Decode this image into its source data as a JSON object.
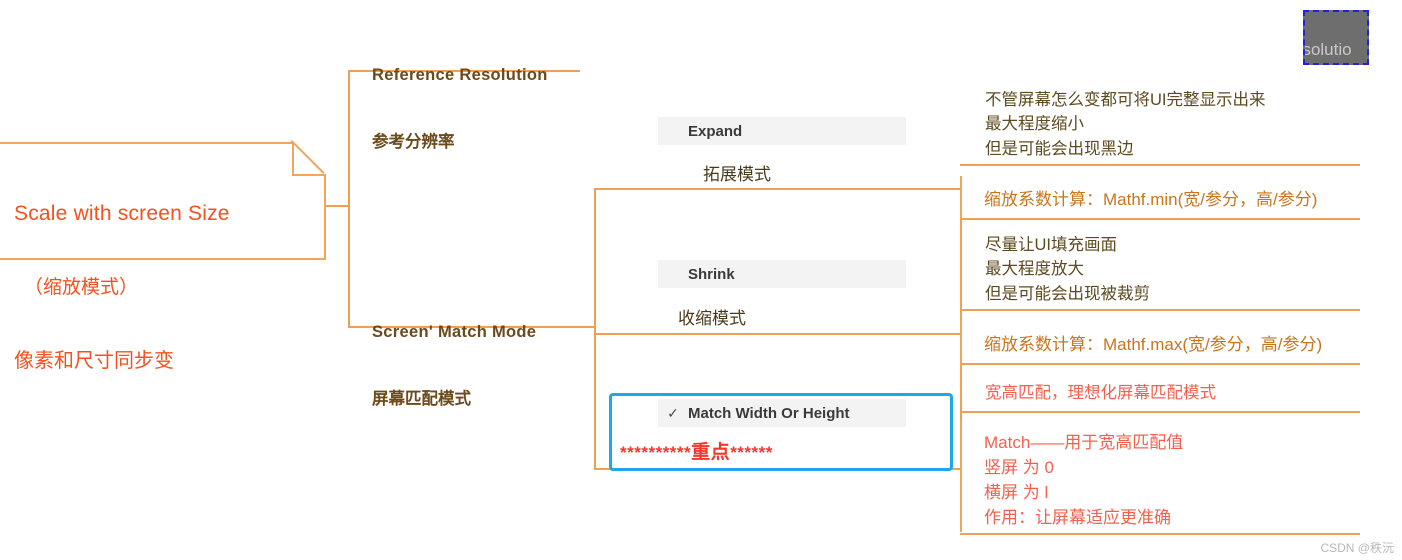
{
  "root": {
    "title_en": "Scale with screen Size",
    "title_cn1": "（缩放模式）",
    "title_cn2": "像素和尺寸同步变"
  },
  "branches": [
    {
      "title_en": "Reference Resolution",
      "title_cn": "参考分辨率"
    },
    {
      "title_en": "Screen' Match Mode",
      "title_cn": "屏幕匹配模式"
    }
  ],
  "options": [
    {
      "label": "Expand",
      "check": "",
      "sub": "拓展模式",
      "desc": "不管屏幕怎么变都可将UI完整显示出来\n最大程度缩小\n但是可能会出现黑边",
      "formula": "缩放系数计算：Mathf.min(宽/参分，高/参分)"
    },
    {
      "label": "Shrink",
      "check": "",
      "sub": "收缩模式",
      "desc": "尽量让UI填充画面\n最大程度放大\n但是可能会出现被裁剪",
      "formula": "缩放系数计算：Mathf.max(宽/参分，高/参分)"
    },
    {
      "label": "Match Width Or Height",
      "check": "✓",
      "sub": "",
      "emphasis_pre": "**********",
      "emphasis_word": "重点",
      "emphasis_post": "******",
      "desc": "宽高匹配，理想化屏幕匹配模式",
      "formula": "Match——用于宽高匹配值\n竖屏 为 0\n横屏 为 l\n作用：让屏幕适应更准确"
    }
  ],
  "image_selection": {
    "caption": "esolutio"
  },
  "watermark": "CSDN @秩沅",
  "colors": {
    "line": "#F3A55C",
    "root_text": "#F4511E",
    "branch_text": "#6B4A1B",
    "desc_text": "#5C4A20",
    "formula_text": "#C8761E",
    "red_text": "#F4604F",
    "star_red": "#F4362B",
    "highlight_border": "#1FA8E8",
    "option_bg": "#F3F3F3"
  }
}
